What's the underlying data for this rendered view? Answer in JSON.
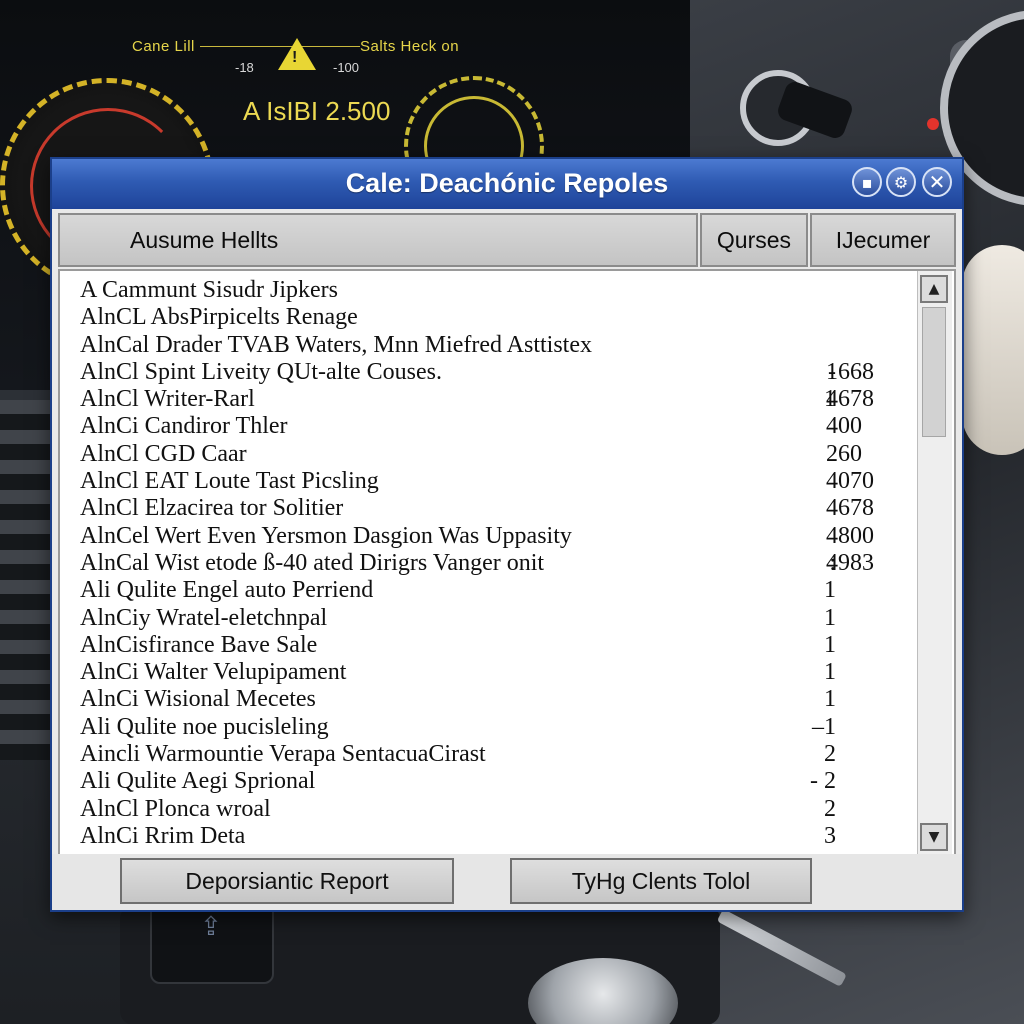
{
  "dashboard": {
    "title_left": "Cane Lill",
    "title_right": "Salts Heck on",
    "scale_left": "-18",
    "scale_right": "-100",
    "readout": "A IsIBI 2.500",
    "warning_icon": "warning-triangle-icon",
    "warning_color": "#e8d634"
  },
  "window": {
    "title": "Cale: Deachónic Repoles",
    "controls": {
      "minimize_glyph": "▪",
      "settings_glyph": "⚙",
      "close_glyph": "✕"
    }
  },
  "table": {
    "headers": {
      "name": "Ausume Hellts",
      "qty": "Qurses",
      "doc": "IJecumer"
    },
    "rows": [
      {
        "name": "A Cammunt Sisudr Jipkers",
        "q": "",
        "v": ""
      },
      {
        "name": "AlnCL AbsPirpicelts Renage",
        "q": "",
        "v": ""
      },
      {
        "name": "AlnCal Drader TVAB Waters, Mnn Miefred Asttistex",
        "q": "",
        "v": ""
      },
      {
        "name": "AlnCl Spint Liveity QUt-alte Couses.",
        "q": "-",
        "v": "1668"
      },
      {
        "name": "AlnCl Writer-Rarl",
        "q": "1",
        "v": "4678"
      },
      {
        "name": "AlnCi Candiror Thler",
        "q": "",
        "v": "400"
      },
      {
        "name": "AlnCl CGD Caar",
        "q": "",
        "v": "260"
      },
      {
        "name": "AlnCl EAT Loute Tast Picsling",
        "q": "",
        "v": "4070"
      },
      {
        "name": "AlnCl Elzacirea tor Solitier",
        "q": "",
        "v": "4678"
      },
      {
        "name": "AlnCel Wert Even Yersmon Dasgion Was Uppasity",
        "q": "",
        "v": "4800"
      },
      {
        "name": "AlnCal Wist etode ß-40 ated Dirigrs Vanger onit",
        "q": ":",
        "v": "4983"
      },
      {
        "name": "Ali Qulite Engel auto Perriend",
        "q": "1",
        "v": ""
      },
      {
        "name": "AlnCiy Wratel-eletchnpal",
        "q": "1",
        "v": ""
      },
      {
        "name": "AlnCisfirance Bave  Sale",
        "q": "1",
        "v": ""
      },
      {
        "name": "AlnCi Walter Velupipament",
        "q": "1",
        "v": ""
      },
      {
        "name": "AlnCi Wisional Mecetes",
        "q": "1",
        "v": ""
      },
      {
        "name": "Ali Qulite noe pucisleling",
        "q": "–1",
        "v": ""
      },
      {
        "name": "Aincli Warmountie Verapa SentacuaCirast",
        "q": "2",
        "v": ""
      },
      {
        "name": "Ali Qulite Aegi Sprional",
        "q": "- 2",
        "v": ""
      },
      {
        "name": "AlnCl Plonca  wroal",
        "q": "2",
        "v": ""
      },
      {
        "name": "AlnCi Rrim Deta",
        "q": "3",
        "v": ""
      }
    ]
  },
  "scrollbar": {
    "up_glyph": "▲",
    "down_glyph": "▼"
  },
  "footer": {
    "report_button": "Deporsiantic Report",
    "clients_button": "TyHg Clents Tolol"
  },
  "colors": {
    "titlebar": "#2f5bb3",
    "accent": "#1b3f8a"
  }
}
